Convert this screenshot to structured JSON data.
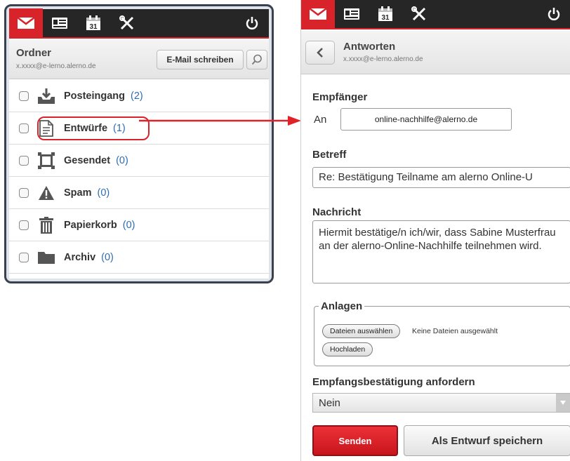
{
  "folders_panel": {
    "title": "Ordner",
    "account": "x.xxxx@e-lerno.alerno.de",
    "compose_label": "E-Mail schreiben",
    "items": [
      {
        "label": "Posteingang",
        "count": "(2)",
        "icon": "inbox-icon"
      },
      {
        "label": "Entwürfe",
        "count": "(1)",
        "icon": "draft-icon"
      },
      {
        "label": "Gesendet",
        "count": "(0)",
        "icon": "sent-icon"
      },
      {
        "label": "Spam",
        "count": "(0)",
        "icon": "warning-icon"
      },
      {
        "label": "Papierkorb",
        "count": "(0)",
        "icon": "trash-icon"
      },
      {
        "label": "Archiv",
        "count": "(0)",
        "icon": "folder-icon"
      }
    ]
  },
  "reply_panel": {
    "title": "Antworten",
    "account": "x.xxxx@e-lerno.alerno.de",
    "recipient_label": "Empfänger",
    "to_prefix": "An",
    "recipient": "online-nachhilfe@alerno.de",
    "subject_label": "Betreff",
    "subject": "Re: Bestätigung Teilname am alerno Online-U",
    "message_label": "Nachricht",
    "message": "Hiermit bestätige/n ich/wir, dass Sabine Musterfrau an der alerno-Online-Nachhilfe teilnehmen wird.",
    "attachments_label": "Anlagen",
    "choose_files": "Dateien auswählen",
    "no_files": "Keine Dateien ausgewählt",
    "upload": "Hochladen",
    "receipt_label": "Empfangsbestätigung anfordern",
    "receipt_value": "Nein",
    "send": "Senden",
    "save_draft": "Als Entwurf speichern"
  },
  "colors": {
    "accent": "#d8232a",
    "navbar": "#262626",
    "link": "#2e6db4"
  }
}
